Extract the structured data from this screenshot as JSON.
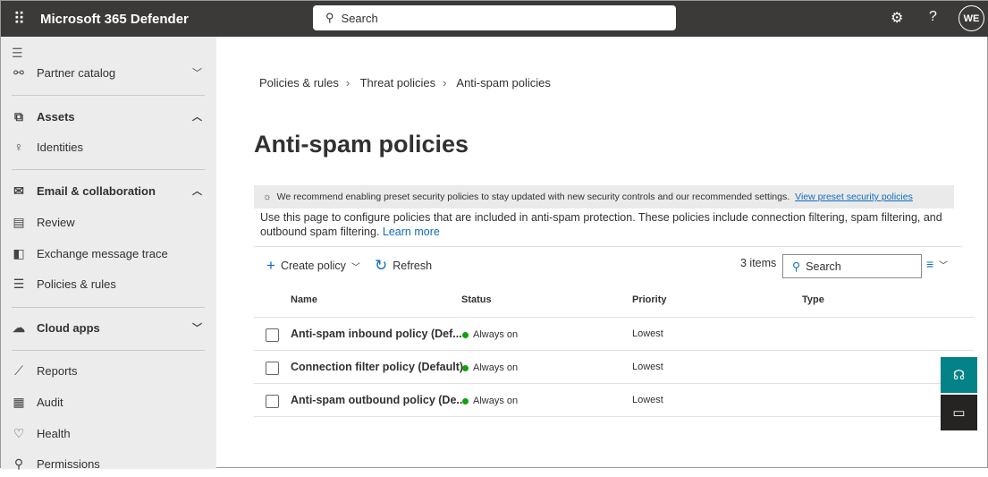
{
  "header": {
    "title": "Microsoft 365 Defender",
    "search_placeholder": "Search",
    "avatar": "WE"
  },
  "sidebar": {
    "items": [
      {
        "label": "Partner catalog",
        "icon": "partner-icon",
        "glyph": "⚯",
        "chev": "﹀"
      },
      {
        "label": "Assets",
        "icon": "assets-icon",
        "glyph": "⧉",
        "chev": "︿",
        "bold": true
      },
      {
        "label": "Identities",
        "icon": "person-icon",
        "glyph": "♀"
      },
      {
        "label": "Email & collaboration",
        "icon": "mail-icon",
        "glyph": "✉",
        "chev": "︿",
        "bold": true
      },
      {
        "label": "Review",
        "icon": "review-icon",
        "glyph": "▤"
      },
      {
        "label": "Exchange message trace",
        "icon": "exchange-icon",
        "glyph": "◧"
      },
      {
        "label": "Policies & rules",
        "icon": "sliders-icon",
        "glyph": "☰"
      },
      {
        "label": "Cloud apps",
        "icon": "cloud-icon",
        "glyph": "☁",
        "chev": "﹀",
        "bold": true
      },
      {
        "label": "Reports",
        "icon": "chart-icon",
        "glyph": "⟋"
      },
      {
        "label": "Audit",
        "icon": "audit-icon",
        "glyph": "▦"
      },
      {
        "label": "Health",
        "icon": "heart-icon",
        "glyph": "♡"
      },
      {
        "label": "Permissions",
        "icon": "key-icon",
        "glyph": "⚲"
      }
    ]
  },
  "breadcrumb": [
    "Policies & rules",
    "Threat policies",
    "Anti-spam policies"
  ],
  "page_title": "Anti-spam policies",
  "banner": {
    "text": "We recommend enabling preset security policies to stay updated with new security controls and our recommended settings.",
    "link": "View preset security policies"
  },
  "description": {
    "text": "Use this page to configure policies that are included in anti-spam protection. These policies include connection filtering, spam filtering, and outbound spam filtering.",
    "link": "Learn more"
  },
  "toolbar": {
    "create": "Create policy",
    "refresh": "Refresh",
    "count": "3 items",
    "search": "Search"
  },
  "table": {
    "columns": [
      "Name",
      "Status",
      "Priority",
      "Type"
    ],
    "rows": [
      {
        "name": "Anti-spam inbound policy (Def...",
        "status": "Always on",
        "priority": "Lowest"
      },
      {
        "name": "Connection filter policy (Default)",
        "status": "Always on",
        "priority": "Lowest"
      },
      {
        "name": "Anti-spam outbound policy (De...",
        "status": "Always on",
        "priority": "Lowest"
      }
    ]
  },
  "colors": {
    "header": "#3b3a39",
    "accent": "#0f6cbd",
    "status_on": "#13a10e",
    "fab_teal": "#038387"
  }
}
